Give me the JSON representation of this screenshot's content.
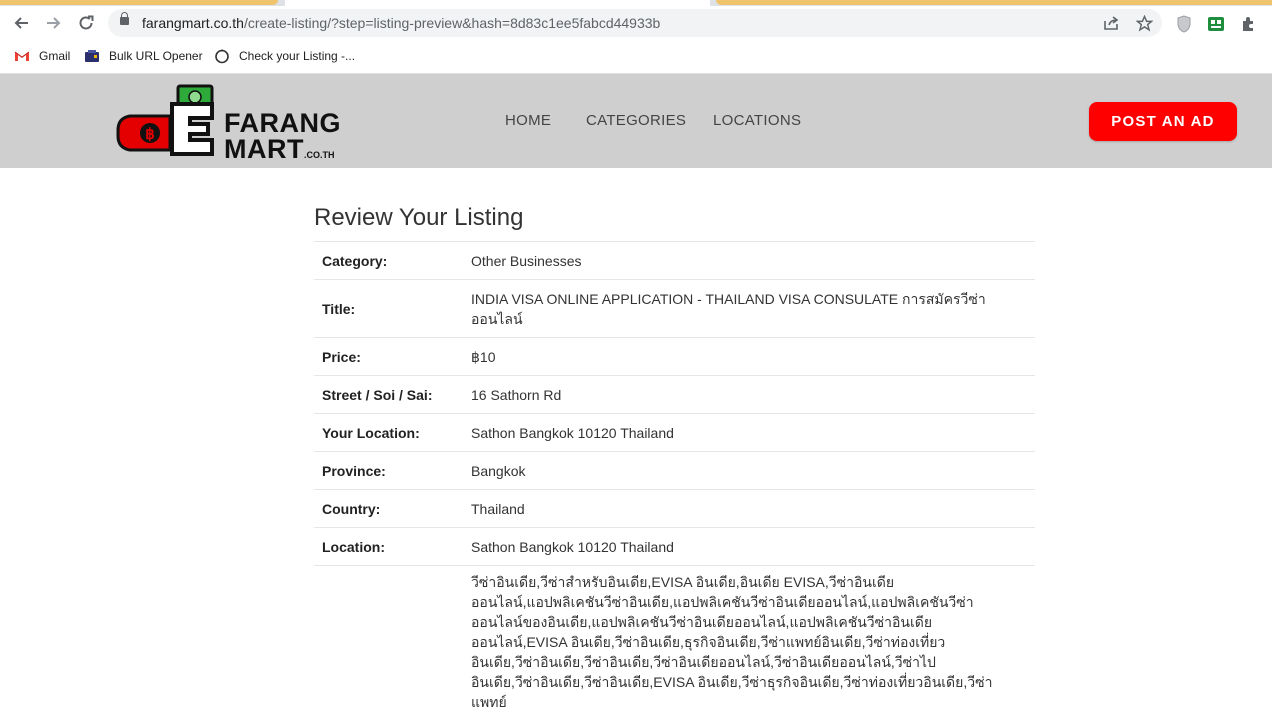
{
  "browser": {
    "url_host": "farangmart.co.th",
    "url_path": "/create-listing/?step=listing-preview&hash=8d83c1ee5fabcd44933b",
    "bookmarks": [
      {
        "label": "Gmail",
        "icon": "gmail-icon"
      },
      {
        "label": "Bulk URL Opener",
        "icon": "bulk-url-opener-icon"
      },
      {
        "label": "Check your Listing -...",
        "icon": "loading-circle-icon"
      }
    ]
  },
  "site": {
    "logo_line1": "FARANG",
    "logo_line2": "MART",
    "logo_tld": ".CO.TH",
    "nav": [
      "HOME",
      "CATEGORIES",
      "LOCATIONS"
    ],
    "post_ad_label": "POST AN AD",
    "brand_color": "#ff0000"
  },
  "review": {
    "heading": "Review Your Listing",
    "rows": [
      {
        "label": "Category:",
        "value": "Other Businesses"
      },
      {
        "label": "Title:",
        "value": "INDIA VISA ONLINE APPLICATION - THAILAND VISA CONSULATE การสมัครวีซ่าออนไลน์"
      },
      {
        "label": "Price:",
        "value": "฿10"
      },
      {
        "label": "Street / Soi / Sai:",
        "value": "16 Sathorn Rd"
      },
      {
        "label": "Your Location:",
        "value": "Sathon Bangkok 10120 Thailand"
      },
      {
        "label": "Province:",
        "value": "Bangkok"
      },
      {
        "label": "Country:",
        "value": "Thailand"
      },
      {
        "label": "Location:",
        "value": "Sathon Bangkok 10120 Thailand"
      }
    ],
    "description": "วีซ่าอินเดีย,วีซ่าสำหรับอินเดีย,EVISA อินเดีย,อินเดีย EVISA,วีซ่าอินเดียออนไลน์,แอปพลิเคชันวีซ่าอินเดีย,แอปพลิเคชันวีซ่าอินเดียออนไลน์,แอปพลิเคชันวีซ่าออนไลน์ของอินเดีย,แอปพลิเคชันวีซ่าอินเดียออนไลน์,แอปพลิเคชันวีซ่าอินเดียออนไลน์,EVISA อินเดีย,วีซ่าอินเดีย,ธุรกิจอินเดีย,วีซ่าแพทย์อินเดีย,วีซ่าท่องเที่ยวอินเดีย,วีซ่าอินเดีย,วีซ่าอินเดีย,วีซ่าอินเดียออนไลน์,วีซ่าอินเดียออนไลน์,วีซ่าไปอินเดีย,วีซ่าอินเดีย,วีซ่าอินเดีย,EVISA อินเดีย,วีซ่าธุรกิจอินเดีย,วีซ่าท่องเที่ยวอินเดีย,วีซ่าแพทย์"
  }
}
